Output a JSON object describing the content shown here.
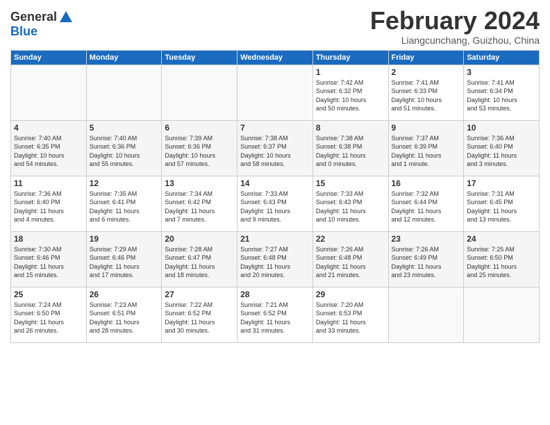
{
  "header": {
    "logo_general": "General",
    "logo_blue": "Blue",
    "month_title": "February 2024",
    "subtitle": "Liangcunchang, Guizhou, China"
  },
  "weekdays": [
    "Sunday",
    "Monday",
    "Tuesday",
    "Wednesday",
    "Thursday",
    "Friday",
    "Saturday"
  ],
  "weeks": [
    [
      {
        "day": "",
        "content": ""
      },
      {
        "day": "",
        "content": ""
      },
      {
        "day": "",
        "content": ""
      },
      {
        "day": "",
        "content": ""
      },
      {
        "day": "1",
        "content": "Sunrise: 7:42 AM\nSunset: 6:32 PM\nDaylight: 10 hours\nand 50 minutes."
      },
      {
        "day": "2",
        "content": "Sunrise: 7:41 AM\nSunset: 6:33 PM\nDaylight: 10 hours\nand 51 minutes."
      },
      {
        "day": "3",
        "content": "Sunrise: 7:41 AM\nSunset: 6:34 PM\nDaylight: 10 hours\nand 53 minutes."
      }
    ],
    [
      {
        "day": "4",
        "content": "Sunrise: 7:40 AM\nSunset: 6:35 PM\nDaylight: 10 hours\nand 54 minutes."
      },
      {
        "day": "5",
        "content": "Sunrise: 7:40 AM\nSunset: 6:36 PM\nDaylight: 10 hours\nand 55 minutes."
      },
      {
        "day": "6",
        "content": "Sunrise: 7:39 AM\nSunset: 6:36 PM\nDaylight: 10 hours\nand 57 minutes."
      },
      {
        "day": "7",
        "content": "Sunrise: 7:38 AM\nSunset: 6:37 PM\nDaylight: 10 hours\nand 58 minutes."
      },
      {
        "day": "8",
        "content": "Sunrise: 7:38 AM\nSunset: 6:38 PM\nDaylight: 11 hours\nand 0 minutes."
      },
      {
        "day": "9",
        "content": "Sunrise: 7:37 AM\nSunset: 6:39 PM\nDaylight: 11 hours\nand 1 minute."
      },
      {
        "day": "10",
        "content": "Sunrise: 7:36 AM\nSunset: 6:40 PM\nDaylight: 11 hours\nand 3 minutes."
      }
    ],
    [
      {
        "day": "11",
        "content": "Sunrise: 7:36 AM\nSunset: 6:40 PM\nDaylight: 11 hours\nand 4 minutes."
      },
      {
        "day": "12",
        "content": "Sunrise: 7:35 AM\nSunset: 6:41 PM\nDaylight: 11 hours\nand 6 minutes."
      },
      {
        "day": "13",
        "content": "Sunrise: 7:34 AM\nSunset: 6:42 PM\nDaylight: 11 hours\nand 7 minutes."
      },
      {
        "day": "14",
        "content": "Sunrise: 7:33 AM\nSunset: 6:43 PM\nDaylight: 11 hours\nand 9 minutes."
      },
      {
        "day": "15",
        "content": "Sunrise: 7:33 AM\nSunset: 6:43 PM\nDaylight: 11 hours\nand 10 minutes."
      },
      {
        "day": "16",
        "content": "Sunrise: 7:32 AM\nSunset: 6:44 PM\nDaylight: 11 hours\nand 12 minutes."
      },
      {
        "day": "17",
        "content": "Sunrise: 7:31 AM\nSunset: 6:45 PM\nDaylight: 11 hours\nand 13 minutes."
      }
    ],
    [
      {
        "day": "18",
        "content": "Sunrise: 7:30 AM\nSunset: 6:46 PM\nDaylight: 11 hours\nand 15 minutes."
      },
      {
        "day": "19",
        "content": "Sunrise: 7:29 AM\nSunset: 6:46 PM\nDaylight: 11 hours\nand 17 minutes."
      },
      {
        "day": "20",
        "content": "Sunrise: 7:28 AM\nSunset: 6:47 PM\nDaylight: 11 hours\nand 18 minutes."
      },
      {
        "day": "21",
        "content": "Sunrise: 7:27 AM\nSunset: 6:48 PM\nDaylight: 11 hours\nand 20 minutes."
      },
      {
        "day": "22",
        "content": "Sunrise: 7:26 AM\nSunset: 6:48 PM\nDaylight: 11 hours\nand 21 minutes."
      },
      {
        "day": "23",
        "content": "Sunrise: 7:26 AM\nSunset: 6:49 PM\nDaylight: 11 hours\nand 23 minutes."
      },
      {
        "day": "24",
        "content": "Sunrise: 7:25 AM\nSunset: 6:50 PM\nDaylight: 11 hours\nand 25 minutes."
      }
    ],
    [
      {
        "day": "25",
        "content": "Sunrise: 7:24 AM\nSunset: 6:50 PM\nDaylight: 11 hours\nand 26 minutes."
      },
      {
        "day": "26",
        "content": "Sunrise: 7:23 AM\nSunset: 6:51 PM\nDaylight: 11 hours\nand 28 minutes."
      },
      {
        "day": "27",
        "content": "Sunrise: 7:22 AM\nSunset: 6:52 PM\nDaylight: 11 hours\nand 30 minutes."
      },
      {
        "day": "28",
        "content": "Sunrise: 7:21 AM\nSunset: 6:52 PM\nDaylight: 11 hours\nand 31 minutes."
      },
      {
        "day": "29",
        "content": "Sunrise: 7:20 AM\nSunset: 6:53 PM\nDaylight: 11 hours\nand 33 minutes."
      },
      {
        "day": "",
        "content": ""
      },
      {
        "day": "",
        "content": ""
      }
    ]
  ]
}
